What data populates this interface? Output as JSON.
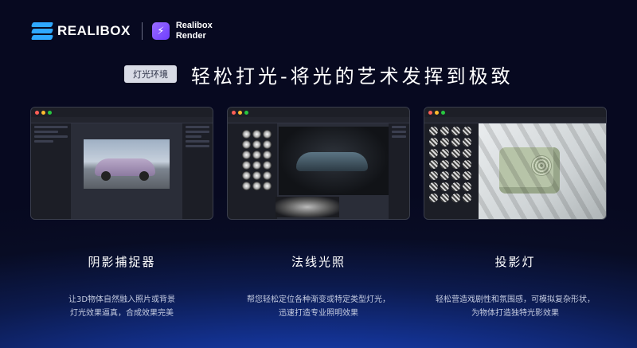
{
  "brand": {
    "name": "REALIBOX",
    "product_line1": "Realibox",
    "product_line2": "Render"
  },
  "tag": "灯光环境",
  "headline": "轻松打光-将光的艺术发挥到极致",
  "features": [
    {
      "title": "阴影捕捉器",
      "desc_line1": "让3D物体自然融入照片或背景",
      "desc_line2": "灯光效果逼真，合成效果完美"
    },
    {
      "title": "法线光照",
      "desc_line1": "帮您轻松定位各种渐变或特定类型灯光，",
      "desc_line2": "迅速打造专业照明效果"
    },
    {
      "title": "投影灯",
      "desc_line1": "轻松营造戏剧性和氛围感，可模拟复杂形状，",
      "desc_line2": "为物体打造独特光影效果"
    }
  ],
  "colors": {
    "accent_blue": "#2fa8ff",
    "accent_purple": "#7a4dff",
    "bg_dark": "#070920"
  }
}
